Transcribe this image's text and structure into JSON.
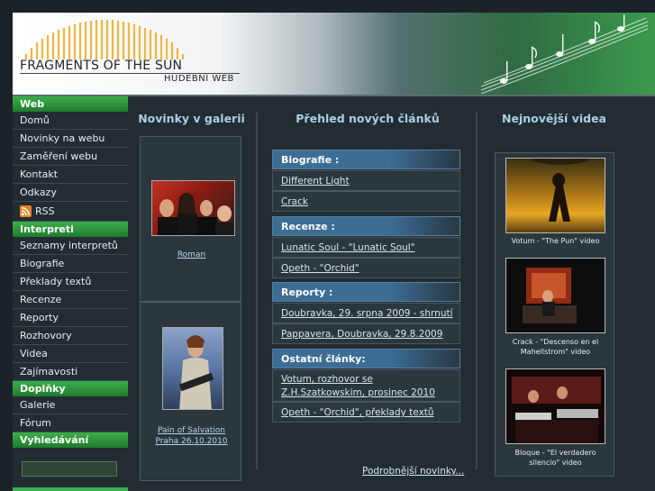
{
  "header": {
    "logo_title": "FRAGMENTS OF THE SUN",
    "logo_subtitle": "HUDEBNÍ WEB"
  },
  "sidebar": {
    "sections": [
      {
        "title": "Web",
        "items": [
          "Domů",
          "Novinky na webu",
          "Zaměření webu",
          "Kontakt",
          "Odkazy",
          "RSS"
        ]
      },
      {
        "title": "Interpreti",
        "items": [
          "Seznamy interpretů",
          "Biografie",
          "Překlady textů",
          "Recenze",
          "Reporty",
          "Rozhovory",
          "Videa",
          "Zajímavosti"
        ]
      },
      {
        "title": "Doplňky",
        "items": [
          "Galerie",
          "Fórum"
        ]
      },
      {
        "title": "Vyhledávání",
        "items": []
      }
    ],
    "search_value": ""
  },
  "gallery": {
    "title": "Novinky v galerii",
    "items": [
      {
        "caption": "Roman"
      },
      {
        "caption_line1": "Pain of Salvation",
        "caption_line2": "Praha 26.10.2010"
      }
    ]
  },
  "articles": {
    "title": "Přehled nových článků",
    "categories": [
      {
        "name": "Biografie :",
        "links": [
          "Different Light",
          "Crack"
        ]
      },
      {
        "name": "Recenze :",
        "links": [
          "Lunatic Soul - \"Lunatic Soul\"",
          "Opeth - \"Orchid\""
        ]
      },
      {
        "name": "Reporty :",
        "links": [
          "Doubravka, 29. srpna 2009 - shrnutí",
          "Pappavera, Doubravka, 29.8.2009"
        ]
      },
      {
        "name": "Ostatní články:",
        "links": [
          "Votum, rozhovor se Z.H.Szatkowskim, prosinec 2010",
          "Opeth - \"Orchid\", překlady textů"
        ]
      }
    ],
    "more_link": "Podrobnější novinky..."
  },
  "videos": {
    "title": "Nejnovější videa",
    "items": [
      {
        "line1": "Votum - \"The Pun\" video"
      },
      {
        "line1": "Crack - \"Descenso en el",
        "line2": "Mahellstrom\" video"
      },
      {
        "line1": "Bloque - \"El verdadero",
        "line2": "silencio\" video"
      }
    ]
  },
  "colors": {
    "accent_green": "#3bb04a",
    "category_blue": "#3c6d95",
    "title_blue": "#a9cfe8",
    "background": "#232c33"
  }
}
